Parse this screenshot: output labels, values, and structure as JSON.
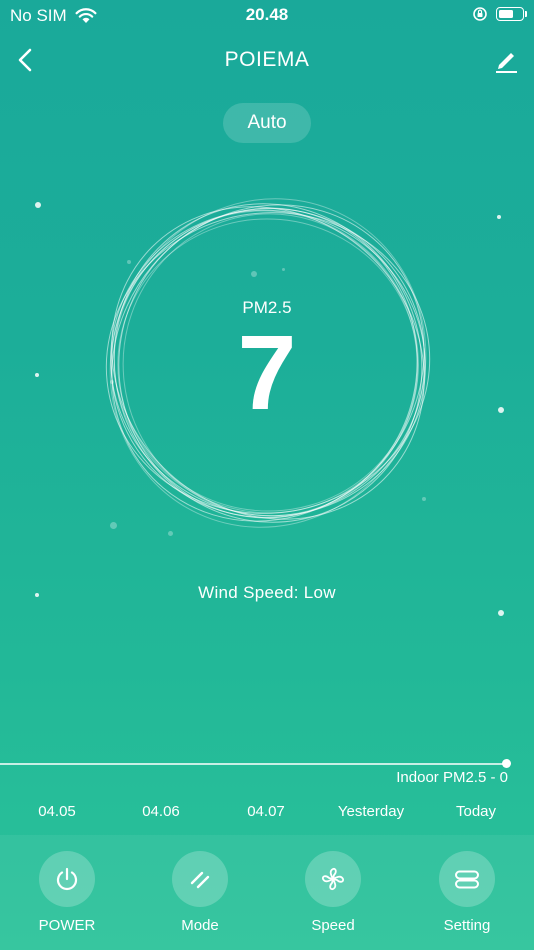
{
  "status": {
    "carrier": "No SIM",
    "time": "20.48",
    "battery_level": 0.65
  },
  "nav": {
    "title": "POIEMA"
  },
  "mode": {
    "label": "Auto"
  },
  "reading": {
    "label": "PM2.5",
    "value": "7"
  },
  "wind": {
    "text": "Wind Speed: Low"
  },
  "history": {
    "indoor_label": "Indoor PM2.5 - 0",
    "dates": [
      "04.05",
      "04.06",
      "04.07",
      "Yesterday",
      "Today"
    ]
  },
  "tabs": [
    {
      "label": "POWER",
      "icon": "power-icon"
    },
    {
      "label": "Mode",
      "icon": "mode-icon"
    },
    {
      "label": "Speed",
      "icon": "fan-icon"
    },
    {
      "label": "Setting",
      "icon": "setting-icon"
    }
  ],
  "colors": {
    "background_top": "#1aa99a",
    "background_bottom": "#2bc39a"
  }
}
